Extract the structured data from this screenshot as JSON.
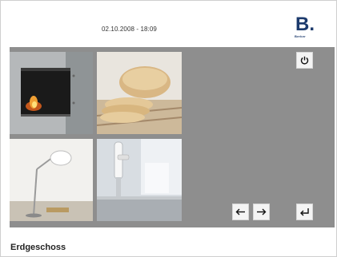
{
  "header": {
    "datetime": "02.10.2008 - 18:09",
    "brand": {
      "letter": "B.",
      "sub": "Berker",
      "color": "#1d3b6d"
    }
  },
  "tiles": [
    {
      "name": "fireplace-tile",
      "icon": "fireplace-image"
    },
    {
      "name": "bread-tile",
      "icon": "bread-image"
    },
    {
      "name": "lamp-tile",
      "icon": "desk-lamp-image"
    },
    {
      "name": "faucet-tile",
      "icon": "faucet-image"
    }
  ],
  "controls": {
    "power": "power-icon",
    "prev": "arrow-left-icon",
    "next": "arrow-right-icon",
    "enter": "enter-icon"
  },
  "footer": {
    "room_name": "Erdgeschoss"
  },
  "colors": {
    "panel_bg": "#8e8e8e",
    "button_bg": "#f4f4f4"
  }
}
